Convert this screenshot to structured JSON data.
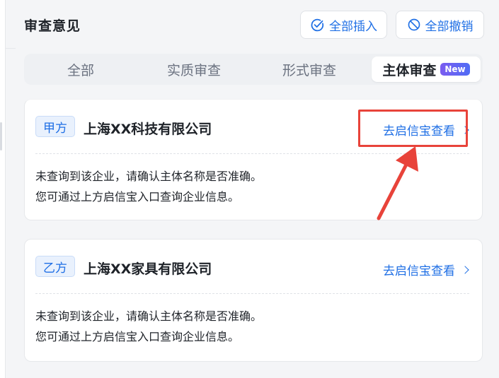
{
  "header": {
    "title": "审查意见",
    "insert_all_label": "全部插入",
    "revoke_all_label": "全部撤销"
  },
  "tabs": [
    {
      "label": "全部"
    },
    {
      "label": "实质审查"
    },
    {
      "label": "形式审查"
    },
    {
      "label": "主体审查",
      "badge": "New",
      "active": true
    }
  ],
  "cards": [
    {
      "party": "甲方",
      "company": "上海XX科技有限公司",
      "link": "去启信宝查看",
      "message_line1": "未查询到该企业，请确认主体名称是否准确。",
      "message_line2": "您可通过上方启信宝入口查询企业信息。"
    },
    {
      "party": "乙方",
      "company": "上海XX家具有限公司",
      "link": "去启信宝查看",
      "message_line1": "未查询到该企业，请确认主体名称是否准确。",
      "message_line2": "您可通过上方启信宝入口查询企业信息。"
    }
  ],
  "colors": {
    "accent": "#1f6fe5",
    "annotation": "#e8433a",
    "badge_start": "#7b5cf0",
    "badge_end": "#4f6cf5"
  },
  "icons": {
    "insert_all": "check-circle-icon",
    "revoke_all": "prohibit-icon",
    "link": "chevron-right-icon"
  }
}
